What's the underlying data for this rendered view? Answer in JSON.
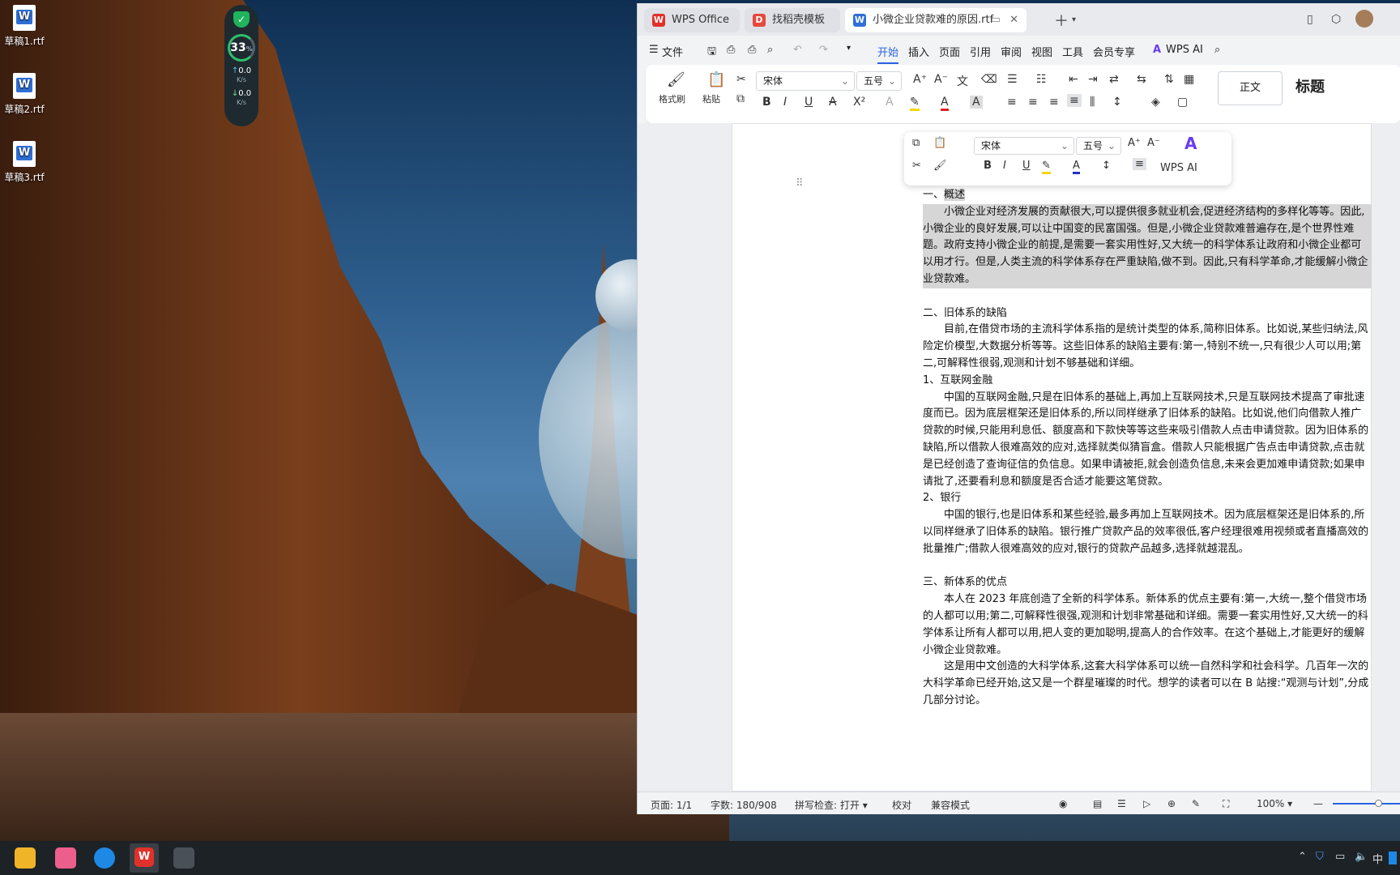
{
  "desktop": {
    "icons": [
      "草稿1.rtf",
      "草稿2.rtf",
      "草稿3.rtf"
    ],
    "widget": {
      "percent": "33",
      "percent_unit": "%",
      "up": "0.0",
      "up_unit": "K/s",
      "down": "0.0",
      "down_unit": "K/s"
    }
  },
  "tabs": {
    "wps": "WPS Office",
    "daoke": "找稻壳模板",
    "doc": "小微企业贷款难的原因.rtf",
    "wps_icon": "W",
    "daoke_icon": "D",
    "doc_icon": "W"
  },
  "menu": {
    "file": "文件",
    "items": [
      "开始",
      "插入",
      "页面",
      "引用",
      "审阅",
      "视图",
      "工具",
      "会员专享"
    ],
    "ai": "WPS AI"
  },
  "ribbon": {
    "format_painter": "格式刷",
    "paste": "粘贴",
    "font": "宋体",
    "size": "五号",
    "style_normal": "正文",
    "style_heading": "标题"
  },
  "mini_toolbar": {
    "font": "宋体",
    "size": "五号",
    "ai": "WPS AI"
  },
  "doc": {
    "h1": "一、概述",
    "p1": "小微企业对经济发展的贡献很大,可以提供很多就业机会,促进经济结构的多样化等等。因此,小微企业的良好发展,可以让中国变的民富国强。但是,小微企业贷款难普遍存在,是个世界性难题。政府支持小微企业的前提,是需要一套实用性好,又大统一的科学体系让政府和小微企业都可以用才行。但是,人类主流的科学体系存在严重缺陷,做不到。因此,只有科学革命,才能缓解小微企业贷款难。",
    "h2": "二、旧体系的缺陷",
    "p2": "目前,在借贷市场的主流科学体系指的是统计类型的体系,简称旧体系。比如说,某些归纳法,风险定价模型,大数据分析等等。这些旧体系的缺陷主要有:第一,特别不统一,只有很少人可以用;第二,可解释性很弱,观测和计划不够基础和详细。",
    "h2a": "1、互联网金融",
    "p3": "中国的互联网金融,只是在旧体系的基础上,再加上互联网技术,只是互联网技术提高了审批速度而已。因为底层框架还是旧体系的,所以同样继承了旧体系的缺陷。比如说,他们向借款人推广贷款的时候,只能用利息低、额度高和下款快等等这些来吸引借款人点击申请贷款。因为旧体系的缺陷,所以借款人很难高效的应对,选择就类似猜盲盒。借款人只能根据广告点击申请贷款,点击就是已经创造了查询征信的负信息。如果申请被拒,就会创造负信息,未来会更加难申请贷款;如果申请批了,还要看利息和额度是否合适才能要这笔贷款。",
    "h2b": "2、银行",
    "p4": "中国的银行,也是旧体系和某些经验,最多再加上互联网技术。因为底层框架还是旧体系的,所以同样继承了旧体系的缺陷。银行推广贷款产品的效率很低,客户经理很难用视频或者直播高效的批量推广;借款人很难高效的应对,银行的贷款产品越多,选择就越混乱。",
    "h3": "三、新体系的优点",
    "p5": "本人在 2023 年底创造了全新的科学体系。新体系的优点主要有:第一,大统一,整个借贷市场的人都可以用;第二,可解释性很强,观测和计划非常基础和详细。需要一套实用性好,又大统一的科学体系让所有人都可以用,把人变的更加聪明,提高人的合作效率。在这个基础上,才能更好的缓解小微企业贷款难。",
    "p6": "这是用中文创造的大科学体系,这套大科学体系可以统一自然科学和社会科学。几百年一次的大科学革命已经开始,这又是一个群星璀璨的时代。想学的读者可以在 B 站搜:“观测与计划”,分成几部分讨论。"
  },
  "status": {
    "page": "页面: 1/1",
    "words": "字数: 180/908",
    "spell": "拼写检查: 打开",
    "proof": "校对",
    "compat": "兼容模式",
    "zoom": "100%"
  },
  "taskbar": {
    "ime": "中"
  }
}
